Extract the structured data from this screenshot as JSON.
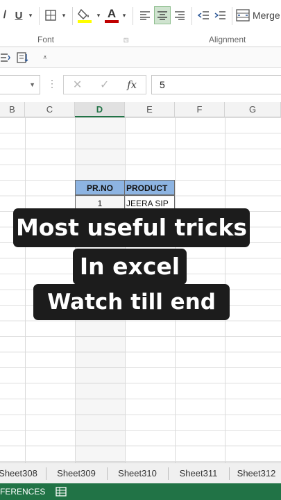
{
  "ribbon": {
    "underline_label": "U",
    "font_color_label": "A",
    "merge_label": "Merge",
    "font_group_label": "Font",
    "alignment_group_label": "Alignment"
  },
  "formula_bar": {
    "fx_label": "fx",
    "value": "5"
  },
  "columns": [
    "B",
    "C",
    "D",
    "E",
    "F",
    "G"
  ],
  "selected_column": "D",
  "table": {
    "headers": [
      "PR.NO",
      "PRODUCT"
    ],
    "row1": [
      "1",
      "JEERA SIP"
    ]
  },
  "caption": {
    "line1": "Most useful tricks",
    "line2": "In excel",
    "line3": "Watch till end"
  },
  "sheet_tabs": [
    "Sheet308",
    "Sheet309",
    "Sheet310",
    "Sheet311",
    "Sheet312"
  ],
  "status": {
    "text": "FERENCES"
  },
  "colors": {
    "accent": "#217346",
    "header_fill": "#8db4e2",
    "caption_bg": "#1c1c1c",
    "font_color_bar": "#c00000",
    "highlight_bar": "#ffff00"
  }
}
